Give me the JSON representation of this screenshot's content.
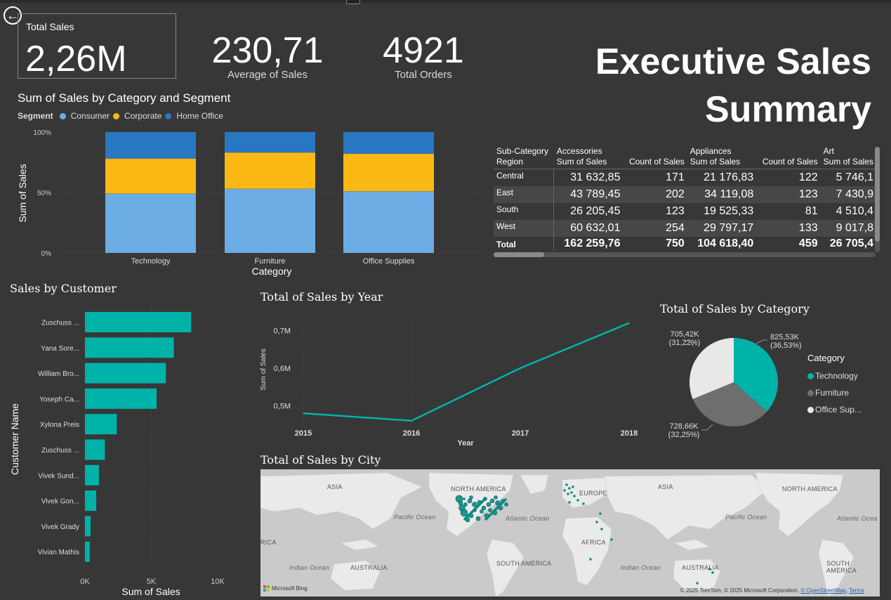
{
  "kpis": {
    "total_sales": {
      "label": "Total Sales",
      "value": "2,26M"
    },
    "avg_sales": {
      "label": "Average of Sales",
      "value": "230,71"
    },
    "total_orders": {
      "label": "Total Orders",
      "value": "4921"
    }
  },
  "page_title": {
    "line1": "Executive Sales",
    "line2": "Summary"
  },
  "icons": {
    "back": "back-arrow-icon"
  },
  "colors": {
    "consumer": "#6cace4",
    "corporate": "#fdb913",
    "home_office": "#2877c2",
    "teal": "#00b3a8",
    "furniture": "#6e6e6e",
    "office": "#e8e8e8",
    "bg": "#373737"
  },
  "segment_chart": {
    "title": "Sum of Sales by Category and Segment",
    "legend_label": "Segment",
    "legend": [
      "Consumer",
      "Corporate",
      "Home Office"
    ]
  },
  "matrix": {
    "header_row1": [
      "Sub-Category",
      "Accessories",
      "",
      "Appliances",
      "",
      "Art"
    ],
    "header_row2": [
      "Region",
      "Sum of Sales",
      "Count of Sales",
      "Sum of Sales",
      "Count of Sales",
      "Sum of Sales"
    ],
    "rows": [
      {
        "region": "Central",
        "cells": [
          "31 632,85",
          "171",
          "21 176,83",
          "122",
          "5 746,1"
        ]
      },
      {
        "region": "East",
        "cells": [
          "43 789,45",
          "202",
          "34 119,08",
          "123",
          "7 430,9"
        ]
      },
      {
        "region": "South",
        "cells": [
          "26 205,45",
          "123",
          "19 525,33",
          "81",
          "4 510,4"
        ]
      },
      {
        "region": "West",
        "cells": [
          "60 632,01",
          "254",
          "29 797,17",
          "133",
          "9 017,8"
        ]
      }
    ],
    "total": {
      "region": "Total",
      "cells": [
        "162 259,76",
        "750",
        "104 618,40",
        "459",
        "26 705,4"
      ]
    }
  },
  "customer_chart": {
    "title": "Sales by Customer"
  },
  "year_chart": {
    "title": "Total of Sales by Year"
  },
  "pie_chart": {
    "title": "Total of Sales by Category",
    "legend_title": "Category",
    "legend": [
      "Technology",
      "Furniture",
      "Office Sup..."
    ]
  },
  "map": {
    "title": "Total of Sales by City",
    "labels": {
      "asia1": "ASIA",
      "north_america1": "NORTH AMERICA",
      "europe": "EUROPE",
      "asia2": "ASIA",
      "north_america2": "NORTH AMERICA",
      "pacific1": "Pacific Ocean",
      "atlantic": "Atlantic Ocean",
      "pacific2": "Pacific Ocean",
      "atlantic2": "Atlantic Ocea",
      "africa_left": "RICA",
      "africa": "AFRICA",
      "indian1": "Indian Ocean",
      "australia1": "AUSTRALIA",
      "south_america1": "SOUTH AMERICA",
      "indian2": "Indian Ocean",
      "australia2": "AUSTRALIA",
      "south_america2": "SOUTH AMERICA"
    },
    "bing_label": "Microsoft Bing",
    "attribution": "© 2025 TomTom, © 2025 Microsoft Corporation,",
    "osm": "© OpenStreetMap",
    "terms": "Terms"
  },
  "chart_data": [
    {
      "type": "bar",
      "title": "Sum of Sales by Category and Segment",
      "stacked": "100%",
      "categories": [
        "Technology",
        "Furniture",
        "Office Supplies"
      ],
      "series": [
        {
          "name": "Consumer",
          "values": [
            0.49,
            0.53,
            0.51
          ]
        },
        {
          "name": "Corporate",
          "values": [
            0.29,
            0.3,
            0.31
          ]
        },
        {
          "name": "Home Office",
          "values": [
            0.22,
            0.17,
            0.18
          ]
        }
      ],
      "xlabel": "Category",
      "ylabel": "Sum of Sales",
      "yticks": [
        "0%",
        "50%",
        "100%"
      ],
      "ylim": [
        0,
        1
      ]
    },
    {
      "type": "bar",
      "orientation": "horizontal",
      "title": "Sales by Customer",
      "categories": [
        "Zuschuss ...",
        "Yana Sore...",
        "William Bro...",
        "Yoseph Ca...",
        "Xylona Preis",
        "Zuschuss ...",
        "Vivek Sund...",
        "Vivek Gon...",
        "Vivek Grady",
        "Vivian Mathis"
      ],
      "values": [
        8000,
        6700,
        6100,
        5400,
        2400,
        1500,
        1050,
        850,
        420,
        360
      ],
      "xlabel": "Sum of Sales",
      "ylabel": "Customer Name",
      "xticks": [
        "0K",
        "5K",
        "10K"
      ],
      "xlim": [
        0,
        10000
      ]
    },
    {
      "type": "line",
      "title": "Total of Sales by Year",
      "x": [
        "2015",
        "2016",
        "2017",
        "2018"
      ],
      "values": [
        0.48,
        0.46,
        0.6,
        0.72
      ],
      "xlabel": "Year",
      "ylabel": "Sum of Sales",
      "yticks": [
        "0,5M",
        "0,6M",
        "0,7M"
      ],
      "ylim": [
        0.44,
        0.74
      ]
    },
    {
      "type": "pie",
      "title": "Total of Sales by Category",
      "categories": [
        "Technology",
        "Furniture",
        "Office Sup..."
      ],
      "values": [
        825.53,
        728.66,
        705.42
      ],
      "data_labels": [
        [
          "825,53K",
          "(36,53%)"
        ],
        [
          "728,66K",
          "(32,25%)"
        ],
        [
          "705,42K",
          "(31,22%)"
        ]
      ]
    }
  ]
}
